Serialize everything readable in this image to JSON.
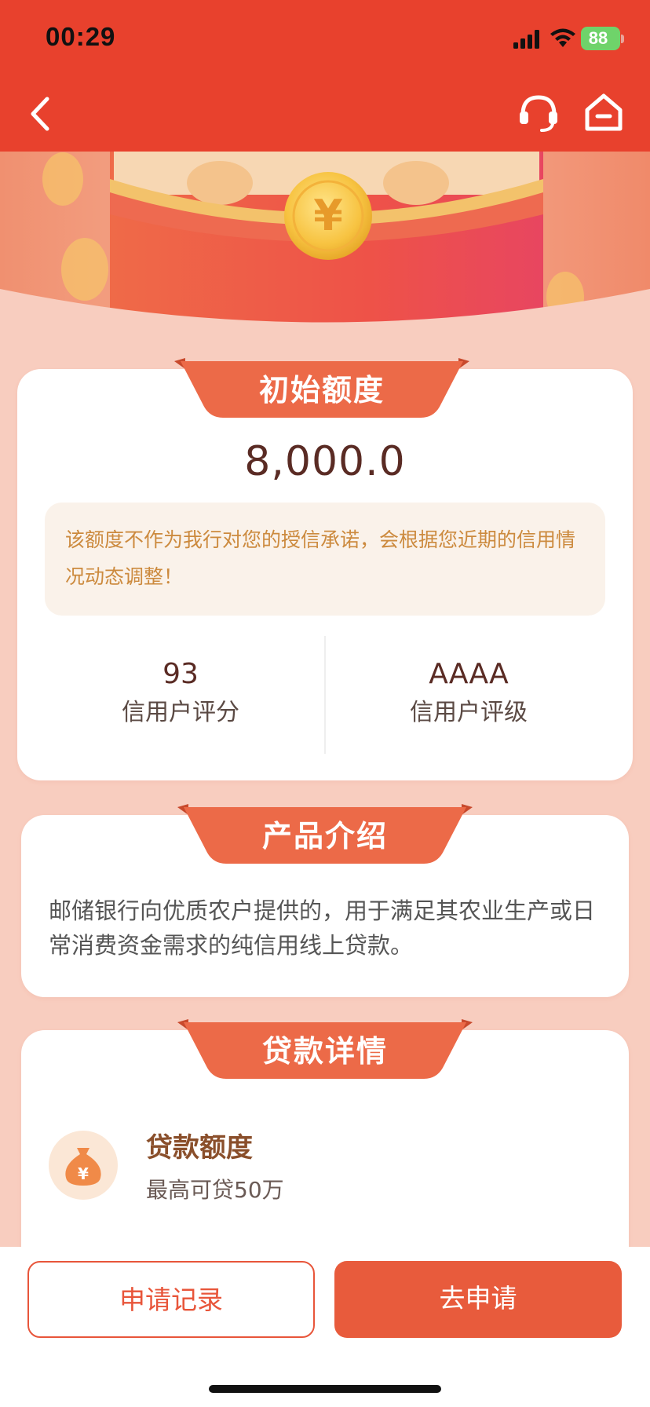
{
  "status_bar": {
    "time": "00:29",
    "battery": "88"
  },
  "nav": {
    "back_icon": "chevron-left-icon",
    "service_icon": "headset-icon",
    "home_icon": "home-icon"
  },
  "banner": {
    "coin_symbol": "¥"
  },
  "quota_card": {
    "title": "初始额度",
    "amount": "8,000.0",
    "notice": "该额度不作为我行对您的授信承诺，会根据您近期的信用情况动态调整！",
    "stats": [
      {
        "value": "93",
        "label": "信用户评分"
      },
      {
        "value": "AAAA",
        "label": "信用户评级"
      }
    ]
  },
  "intro_card": {
    "title": "产品介绍",
    "text": "邮储银行向优质农户提供的，用于满足其农业生产或日常消费资金需求的纯信用线上贷款。"
  },
  "detail_card": {
    "title": "贷款详情",
    "item_icon": "money-bag-icon",
    "item_symbol": "¥",
    "item_title": "贷款额度",
    "item_sub": "最高可贷50万"
  },
  "bottom": {
    "records_label": "申请记录",
    "apply_label": "去申请"
  },
  "colors": {
    "header_red": "#e8412d",
    "page_bg": "#f8cdbf",
    "ribbon_orange": "#ec6a48",
    "button_orange": "#e85b3c",
    "amount_brown": "#5a2b24",
    "notice_text": "#cc8a3e"
  }
}
